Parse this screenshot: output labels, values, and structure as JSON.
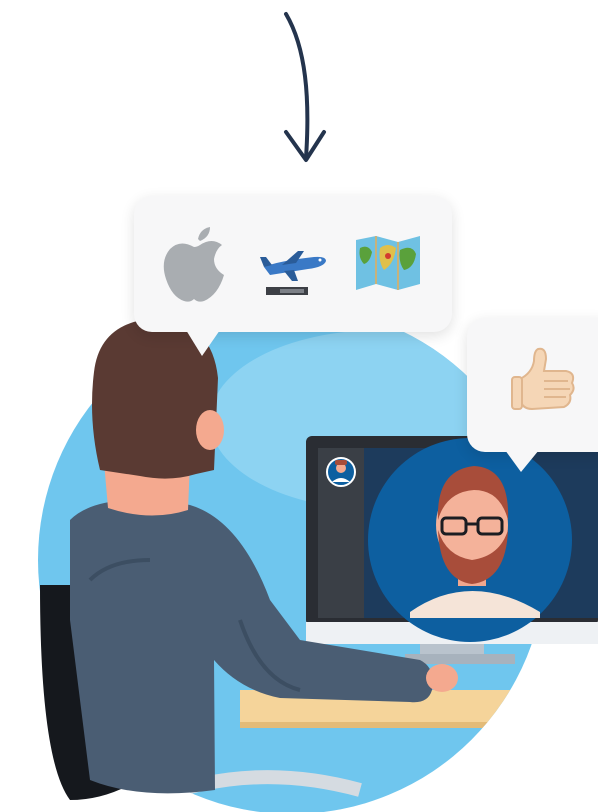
{
  "illustration": {
    "icons": [
      "arrow-down-icon",
      "apple-icon",
      "airplane-icon",
      "map-icon",
      "thumbs-up-icon"
    ],
    "colors": {
      "background_circle": "#6fc6ee",
      "skin": "#f4a98f",
      "hair": "#5a3a33",
      "shirt": "#4a5d73",
      "chair": "#15181d",
      "monitor_frame": "#2a2d33",
      "screen_bg": "#1d3b5c",
      "call_circle": "#0d5fa0",
      "desk": "#f5d49a"
    }
  }
}
